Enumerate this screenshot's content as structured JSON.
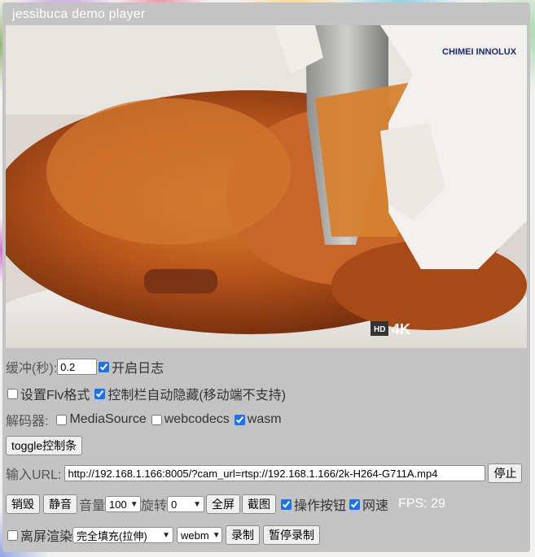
{
  "window": {
    "title": "jessibuca demo player"
  },
  "video": {
    "brand_logo": "CHIMEI INNOLUX",
    "watermark_badges": [
      "4K",
      "HD"
    ]
  },
  "buffer": {
    "label": "缓冲(秒):",
    "value": "0.2",
    "log_label": "开启日志",
    "log_checked": true
  },
  "options": {
    "flv_label": "设置Flv格式",
    "flv_checked": false,
    "autohide_label": "控制栏自动隐藏(移动端不支持)",
    "autohide_checked": true
  },
  "decoder": {
    "label": "解码器:",
    "mediasource_label": "MediaSource",
    "mediasource_checked": false,
    "webcodecs_label": "webcodecs",
    "webcodecs_checked": false,
    "wasm_label": "wasm",
    "wasm_checked": true
  },
  "toggle_button": "toggle控制条",
  "url": {
    "label": "输入URL:",
    "value": "http://192.168.1.166:8005/?cam_url=rtsp://192.168.1.166/2k-H264-G711A.mp4",
    "stop_button": "停止"
  },
  "controls": {
    "destroy_button": "销毁",
    "mute_button": "静音",
    "volume_label": "音量",
    "volume_value": "100",
    "rotate_label": "旋转",
    "rotate_value": "0",
    "fullscreen_button": "全屏",
    "screenshot_button": "截图",
    "op_buttons_label": "操作按钮",
    "op_buttons_checked": true,
    "netspeed_label": "网速",
    "netspeed_checked": true,
    "fps_text": "FPS: 29"
  },
  "render": {
    "offscreen_label": "离屏渲染",
    "offscreen_checked": false,
    "fill_mode_value": "完全填充(拉伸)",
    "format_value": "webm",
    "record_button": "录制",
    "pause_record_button": "暂停录制"
  }
}
